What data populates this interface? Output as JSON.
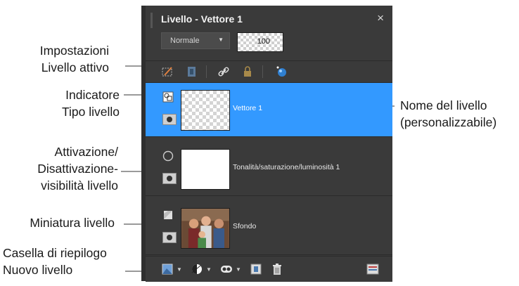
{
  "annotations": {
    "impostazioni": "Impostazioni\nLivello attivo",
    "indicatore": "Indicatore\nTipo livello",
    "attivazione": "Attivazione/\nDisattivazione-\nvisibilità livello",
    "miniatura": "Miniatura livello",
    "casella": "Casella di riepilogo\nNuovo livello",
    "nome": "Nome del livello\n(personalizzabile)"
  },
  "panel": {
    "title": "Livello - Vettore 1",
    "close_glyph": "×",
    "blend_mode": "Normale",
    "opacity": "100"
  },
  "layers": [
    {
      "name": "Vettore 1",
      "selected": true
    },
    {
      "name": "Tonalità/saturazione/luminosità 1",
      "selected": false
    },
    {
      "name": "Sfondo",
      "selected": false
    }
  ],
  "colors": {
    "selected": "#3399ff",
    "panel": "#3a3a3a"
  }
}
